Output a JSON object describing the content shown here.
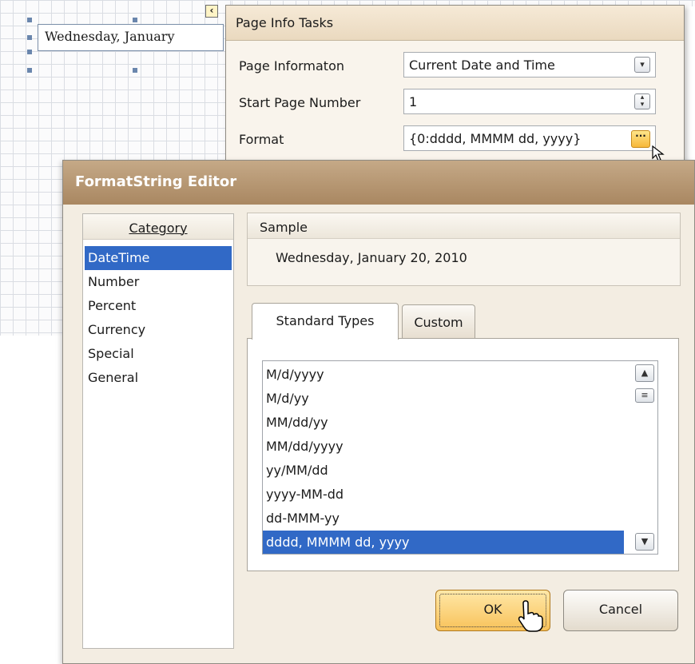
{
  "designer": {
    "label_text": "Wednesday, January"
  },
  "page_info_tasks": {
    "title": "Page Info Tasks",
    "rows": [
      {
        "label": "Page Informaton",
        "value": "Current Date and Time",
        "button": "chevron-down-icon"
      },
      {
        "label": "Start Page Number",
        "value": "1",
        "button": "spin-icon"
      },
      {
        "label": "Format",
        "value": "{0:dddd, MMMM dd, yyyy}",
        "button": "ellipsis-icon"
      }
    ]
  },
  "editor": {
    "title": "FormatString Editor",
    "category_header": "Category",
    "categories": [
      "DateTime",
      "Number",
      "Percent",
      "Currency",
      "Special",
      "General"
    ],
    "selected_category": "DateTime",
    "sample_header": "Sample",
    "sample_text": "Wednesday, January 20, 2010",
    "tabs": [
      "Standard Types",
      "Custom"
    ],
    "active_tab": "Standard Types",
    "types": [
      "M/d/yyyy",
      "M/d/yy",
      "MM/dd/yy",
      "MM/dd/yyyy",
      "yy/MM/dd",
      "yyyy-MM-dd",
      "dd-MMM-yy",
      "dddd, MMMM dd, yyyy"
    ],
    "selected_type": "dddd, MMMM dd, yyyy",
    "ok_label": "OK",
    "cancel_label": "Cancel"
  },
  "colors": {
    "selection": "#3169c6",
    "title_bar": "#b39470",
    "ok_button": "#f8c25a"
  }
}
